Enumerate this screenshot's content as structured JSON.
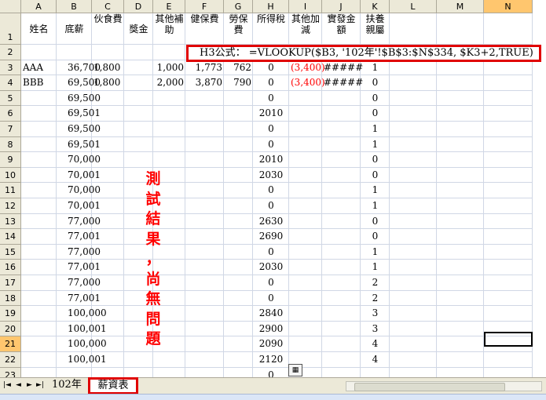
{
  "columns": [
    "A",
    "B",
    "C",
    "D",
    "E",
    "F",
    "G",
    "H",
    "I",
    "J",
    "K",
    "L",
    "M",
    "N"
  ],
  "header_row": {
    "A": "姓名",
    "B": "底薪",
    "C": "伙食費",
    "D": "獎金",
    "E": "其他補助",
    "F": "健保費",
    "G": "勞保費",
    "H": "所得稅",
    "I": "其他加減",
    "J": "實發金額",
    "K": "扶養親屬"
  },
  "formula_label": "H3公式：",
  "formula": "=VLOOKUP($B3, '102年'!$B$3:$N$334, $K3+2,TRUE)",
  "rows": [
    {
      "n": "3",
      "A": "AAA",
      "B": "36,700",
      "C": "1,800",
      "D": "",
      "E": "1,000",
      "F": "1,773",
      "G": "762",
      "H": "0",
      "I": "(3,400)",
      "J": "#####",
      "K": "1"
    },
    {
      "n": "4",
      "A": "BBB",
      "B": "69,500",
      "C": "1,800",
      "D": "",
      "E": "2,000",
      "F": "3,870",
      "G": "790",
      "H": "0",
      "I": "(3,400)",
      "J": "#####",
      "K": "0"
    },
    {
      "n": "5",
      "A": "",
      "B": "69,500",
      "H": "0",
      "K": "0"
    },
    {
      "n": "6",
      "A": "",
      "B": "69,501",
      "H": "2010",
      "K": "0"
    },
    {
      "n": "7",
      "A": "",
      "B": "69,500",
      "H": "0",
      "K": "1"
    },
    {
      "n": "8",
      "A": "",
      "B": "69,501",
      "H": "0",
      "K": "1"
    },
    {
      "n": "9",
      "A": "",
      "B": "70,000",
      "H": "2010",
      "K": "0"
    },
    {
      "n": "10",
      "A": "",
      "B": "70,001",
      "H": "2030",
      "K": "0"
    },
    {
      "n": "11",
      "A": "",
      "B": "70,000",
      "H": "0",
      "K": "1"
    },
    {
      "n": "12",
      "A": "",
      "B": "70,001",
      "H": "0",
      "K": "1"
    },
    {
      "n": "13",
      "A": "",
      "B": "77,000",
      "H": "2630",
      "K": "0"
    },
    {
      "n": "14",
      "A": "",
      "B": "77,001",
      "H": "2690",
      "K": "0"
    },
    {
      "n": "15",
      "A": "",
      "B": "77,000",
      "H": "0",
      "K": "1"
    },
    {
      "n": "16",
      "A": "",
      "B": "77,001",
      "H": "2030",
      "K": "1"
    },
    {
      "n": "17",
      "A": "",
      "B": "77,000",
      "H": "0",
      "K": "2"
    },
    {
      "n": "18",
      "A": "",
      "B": "77,001",
      "H": "0",
      "K": "2"
    },
    {
      "n": "19",
      "A": "",
      "B": "100,000",
      "H": "2840",
      "K": "3"
    },
    {
      "n": "20",
      "A": "",
      "B": "100,001",
      "H": "2900",
      "K": "3"
    },
    {
      "n": "21",
      "A": "",
      "B": "100,000",
      "H": "2090",
      "K": "4"
    },
    {
      "n": "22",
      "A": "",
      "B": "100,001",
      "H": "2120",
      "K": "4"
    },
    {
      "n": "23",
      "A": "",
      "B": "",
      "H": "0",
      "K": ""
    }
  ],
  "annotation_text": [
    "測",
    "試",
    "結",
    "果",
    "，",
    "尚",
    "無",
    "問",
    "題"
  ],
  "sheet_tabs": [
    "102年",
    "薪資表"
  ],
  "active_tab": "薪資表",
  "selected_cell": "N21",
  "colors": {
    "highlight": "#e00000",
    "header_bg": "#ece9d8",
    "selected_header": "#ffc66e"
  }
}
